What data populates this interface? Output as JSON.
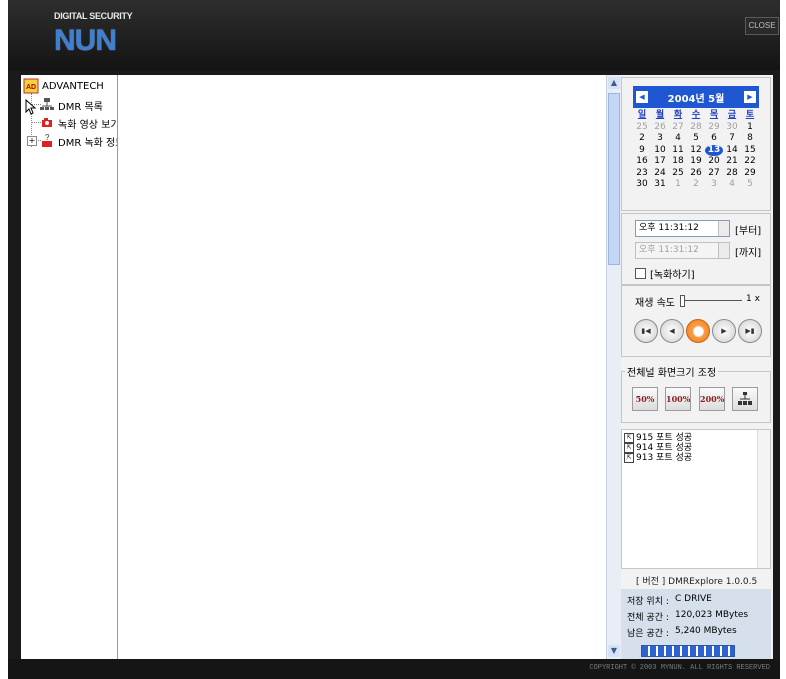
{
  "header": {
    "brand_top": "DIGITAL SECURITY",
    "brand_main": "NUN",
    "close_label": "CLOSE"
  },
  "tree": {
    "root": "ADVANTECH",
    "items": [
      {
        "label": "DMR 목록",
        "icon": "network-icon"
      },
      {
        "label": "녹화 영상 보기",
        "icon": "camera-icon"
      },
      {
        "label": "DMR 녹화 정보",
        "icon": "recording-help-icon"
      }
    ]
  },
  "calendar": {
    "title": "2004년 5월",
    "prev": "◀",
    "next": "▶",
    "weekdays": [
      "일",
      "월",
      "화",
      "수",
      "목",
      "금",
      "토"
    ],
    "days": [
      {
        "d": "25",
        "m": true
      },
      {
        "d": "26",
        "m": true
      },
      {
        "d": "27",
        "m": true
      },
      {
        "d": "28",
        "m": true
      },
      {
        "d": "29",
        "m": true
      },
      {
        "d": "30",
        "m": true
      },
      {
        "d": "1"
      },
      {
        "d": "2"
      },
      {
        "d": "3"
      },
      {
        "d": "4"
      },
      {
        "d": "5"
      },
      {
        "d": "6"
      },
      {
        "d": "7"
      },
      {
        "d": "8"
      },
      {
        "d": "9"
      },
      {
        "d": "10"
      },
      {
        "d": "11"
      },
      {
        "d": "12"
      },
      {
        "d": "13",
        "sel": true
      },
      {
        "d": "14"
      },
      {
        "d": "15"
      },
      {
        "d": "16"
      },
      {
        "d": "17"
      },
      {
        "d": "18"
      },
      {
        "d": "19"
      },
      {
        "d": "20"
      },
      {
        "d": "21"
      },
      {
        "d": "22"
      },
      {
        "d": "23"
      },
      {
        "d": "24"
      },
      {
        "d": "25"
      },
      {
        "d": "26"
      },
      {
        "d": "27"
      },
      {
        "d": "28"
      },
      {
        "d": "29"
      },
      {
        "d": "30"
      },
      {
        "d": "31"
      },
      {
        "d": "1",
        "m": true
      },
      {
        "d": "2",
        "m": true
      },
      {
        "d": "3",
        "m": true
      },
      {
        "d": "4",
        "m": true
      },
      {
        "d": "5",
        "m": true
      }
    ]
  },
  "time": {
    "from_value": "오후 11:31:12",
    "from_label": "[부터]",
    "to_value": "오후 11:31:12",
    "to_label": "[까지]",
    "record_label": "[녹화하기]"
  },
  "playback": {
    "speed_label": "재생 속도",
    "speed_value": "1 x",
    "speed_level": 0.0
  },
  "zoom": {
    "legend": "전체널 화면크기 조정",
    "b50": "50%",
    "b100": "100%",
    "b200": "200%"
  },
  "log": [
    "915 포트 성공",
    "914 포트 성공",
    "913 포트 성공"
  ],
  "version": "[ 버전 ] DMRExplore 1.0.0.5",
  "storage": {
    "location_label": "저장 위치 :",
    "location_value": "C DRIVE",
    "total_label": "전체 공간 :",
    "total_value": "120,023 MBytes",
    "free_label": "남은 공간 :",
    "free_value": "5,240 MBytes"
  },
  "footer": {
    "copyright": "COPYRIGHT © 2003 MYNUN. ALL RIGHTS RESERVED"
  }
}
